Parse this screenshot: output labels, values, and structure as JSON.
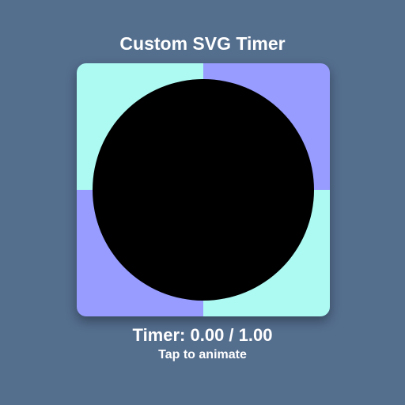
{
  "app": {
    "title": "Custom SVG Timer"
  },
  "timer": {
    "readout": "Timer: 0.00 / 1.00",
    "elapsed": 0.0,
    "duration": 1.0,
    "hint": "Tap to animate"
  },
  "colors": {
    "background": "#546e8e",
    "quadrant_cyan": "#adfaf3",
    "quadrant_violet": "#979cfe",
    "circle_fill": "#000000",
    "text": "#ffffff"
  }
}
